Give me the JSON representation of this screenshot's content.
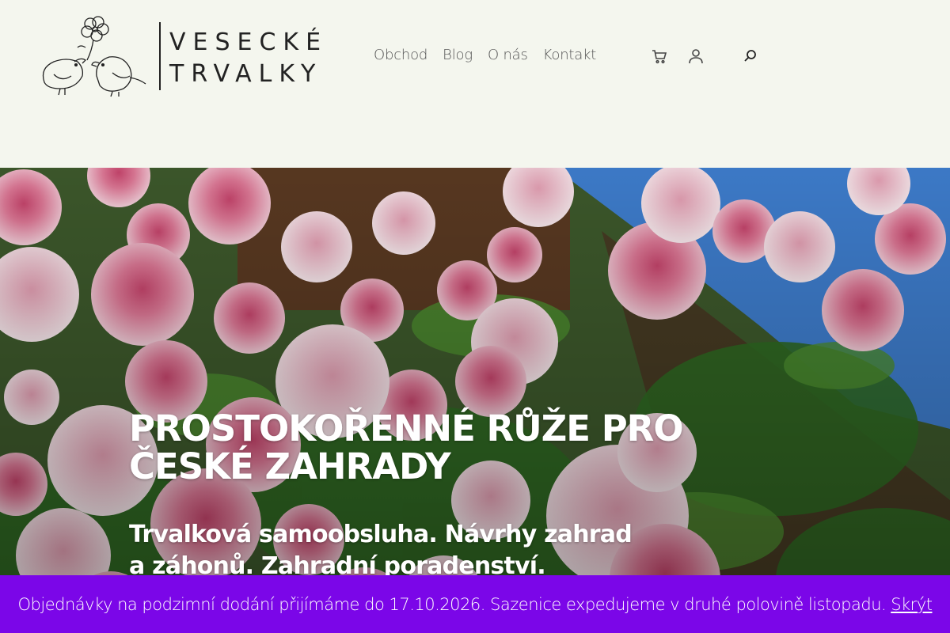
{
  "brand": {
    "line1": "VESECKÉ",
    "line2": "TRVALKY"
  },
  "nav": {
    "items": [
      {
        "label": "Obchod"
      },
      {
        "label": "Blog"
      },
      {
        "label": "O nás"
      },
      {
        "label": "Kontakt"
      }
    ]
  },
  "header_icons": [
    "cart-icon",
    "account-icon",
    "search-icon"
  ],
  "hero": {
    "title": "PROSTOKOŘENNÉ RŮŽE PRO ČESKÉ ZAHRADY",
    "subtitle": "Trvalková samoobsluha. Návrhy zahrad a záhonů. Zahradní poradenství."
  },
  "notice": {
    "text": "Objednávky na podzimní dodání přijímáme do 17.10.2026. Sazenice expedujeme v druhé polovině listopadu.",
    "dismiss_label": "Skrýt"
  },
  "colors": {
    "header_bg": "#f4f6ee",
    "notice_bg": "#7b06e8",
    "hero_text": "#ffffff"
  }
}
